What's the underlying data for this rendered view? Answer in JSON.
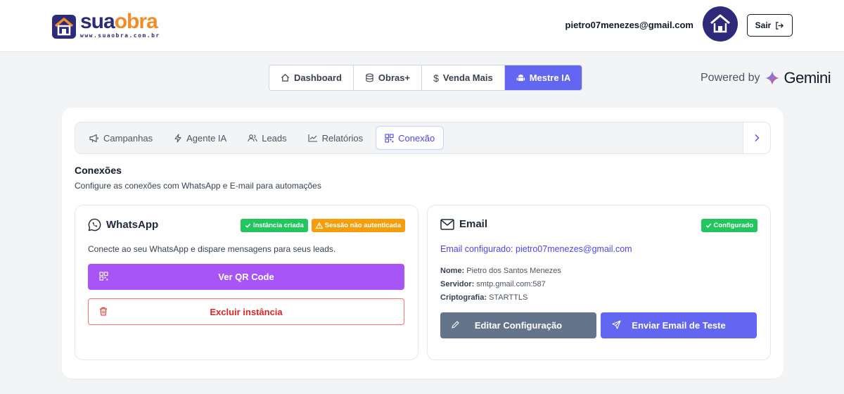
{
  "header": {
    "logo_word_1": "sua",
    "logo_word_2": "obra",
    "logo_url": "www.suaobra.com.br",
    "user_email": "pietro07menezes@gmail.com",
    "logout_label": "Sair"
  },
  "main_nav": {
    "items": [
      {
        "label": "Dashboard",
        "icon": "home-icon"
      },
      {
        "label": "Obras+",
        "icon": "database-icon"
      },
      {
        "label": "Venda Mais",
        "icon": "dollar-icon"
      },
      {
        "label": "Mestre IA",
        "icon": "android-icon"
      }
    ],
    "active_index": 3
  },
  "powered": {
    "prefix": "Powered by",
    "brand": "Gemini"
  },
  "subtabs": {
    "items": [
      {
        "label": "Campanhas",
        "icon": "megaphone-icon"
      },
      {
        "label": "Agente IA",
        "icon": "lightning-icon"
      },
      {
        "label": "Leads",
        "icon": "users-icon"
      },
      {
        "label": "Relatórios",
        "icon": "chart-line-icon"
      },
      {
        "label": "Conexão",
        "icon": "qr-code-icon"
      }
    ],
    "active_index": 4
  },
  "section": {
    "title": "Conexões",
    "description": "Configure as conexões com WhatsApp e E-mail para automações"
  },
  "whatsapp": {
    "title": "WhatsApp",
    "badge_instance": "Instância criada",
    "badge_session": "Sessão não autenticada",
    "description": "Conecte ao seu WhatsApp e dispare mensagens para seus leads.",
    "qr_button": "Ver QR Code",
    "delete_button": "Excluir instância"
  },
  "email": {
    "title": "Email",
    "badge": "Configurado",
    "configured_label": "Email configurado:",
    "configured_value": "pietro07menezes@gmail.com",
    "name_label": "Nome:",
    "name_value": "Pietro dos Santos Menezes",
    "server_label": "Servidor:",
    "server_value": "smtp.gmail.com:587",
    "crypto_label": "Criptografia:",
    "crypto_value": "STARTTLS",
    "edit_button": "Editar Configuração",
    "send_button": "Enviar Email de Teste"
  },
  "colors": {
    "brand_dark": "#2d2a7a",
    "brand_orange": "#f28c28",
    "accent": "#6366f1",
    "purple": "#a855f7",
    "danger": "#dc2626",
    "success": "#22c55e",
    "warning": "#f59e0b",
    "slate": "#64748b"
  }
}
